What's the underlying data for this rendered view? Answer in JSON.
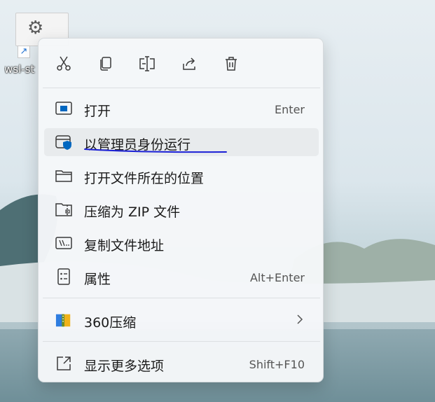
{
  "desktop": {
    "icon_label": "wsl-st",
    "icon_name": "gear-icon"
  },
  "toolbar": {
    "buttons": [
      {
        "name": "cut",
        "icon": "scissors-icon"
      },
      {
        "name": "copy",
        "icon": "copy-icon"
      },
      {
        "name": "rename",
        "icon": "rename-icon"
      },
      {
        "name": "share",
        "icon": "share-icon"
      },
      {
        "name": "delete",
        "icon": "trash-icon"
      }
    ]
  },
  "menu": {
    "items": [
      {
        "label": "打开",
        "shortcut": "Enter",
        "icon": "open-app-icon"
      },
      {
        "label": "以管理员身份运行",
        "shortcut": "",
        "icon": "admin-shield-icon"
      },
      {
        "label": "打开文件所在的位置",
        "shortcut": "",
        "icon": "folder-icon"
      },
      {
        "label": "压缩为 ZIP 文件",
        "shortcut": "",
        "icon": "zip-folder-icon"
      },
      {
        "label": "复制文件地址",
        "shortcut": "",
        "icon": "copy-path-icon"
      },
      {
        "label": "属性",
        "shortcut": "Alt+Enter",
        "icon": "properties-icon"
      },
      {
        "label": "360压缩",
        "shortcut": "",
        "icon": "archive-360-icon"
      },
      {
        "label": "显示更多选项",
        "shortcut": "Shift+F10",
        "icon": "more-options-icon"
      }
    ]
  },
  "colors": {
    "accent": "#0067c0",
    "annotation_underline": "#1a1fd6"
  }
}
